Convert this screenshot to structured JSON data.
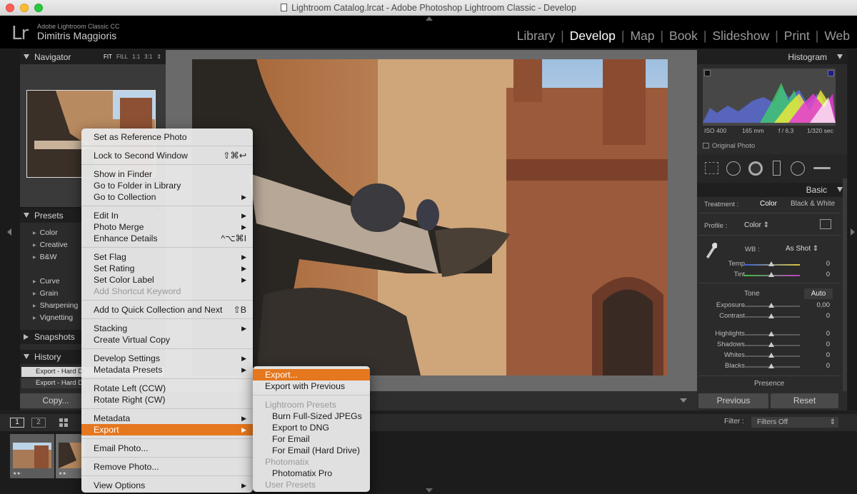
{
  "window": {
    "title": "Lightroom Catalog.lrcat - Adobe Photoshop Lightroom Classic - Develop"
  },
  "brand": {
    "logo": "Lr",
    "product": "Adobe Lightroom Classic CC",
    "user": "Dimitris Maggioris"
  },
  "modules": [
    {
      "label": "Library",
      "active": false
    },
    {
      "label": "Develop",
      "active": true
    },
    {
      "label": "Map",
      "active": false
    },
    {
      "label": "Book",
      "active": false
    },
    {
      "label": "Slideshow",
      "active": false
    },
    {
      "label": "Print",
      "active": false
    },
    {
      "label": "Web",
      "active": false
    }
  ],
  "left_panel": {
    "navigator": {
      "title": "Navigator",
      "zoom": [
        "FIT",
        "FILL",
        "1:1",
        "3:1"
      ]
    },
    "presets": {
      "title": "Presets",
      "items": [
        "Color",
        "Creative",
        "B&W",
        "Curve",
        "Grain",
        "Sharpening",
        "Vignetting"
      ]
    },
    "snapshots": {
      "title": "Snapshots"
    },
    "history": {
      "title": "History",
      "items": [
        "Export - Hard Dr",
        "Export - Hard Dr"
      ]
    },
    "copy_button": "Copy..."
  },
  "right_panel": {
    "histogram": {
      "title": "Histogram",
      "iso": "ISO 400",
      "focal": "165 mm",
      "aperture": "f / 6,3",
      "shutter": "1/320 sec",
      "original_photo": "Original Photo"
    },
    "basic": {
      "title": "Basic",
      "treatment_label": "Treatment :",
      "treatment_color": "Color",
      "treatment_bw": "Black & White",
      "profile_label": "Profile :",
      "profile_value": "Color",
      "wb_label": "WB :",
      "wb_value": "As Shot",
      "tone_label": "Tone",
      "auto_label": "Auto",
      "presence_label": "Presence",
      "sliders": [
        {
          "label": "Temp",
          "value": "0"
        },
        {
          "label": "Tint",
          "value": "0"
        },
        {
          "label": "Exposure",
          "value": "0,00"
        },
        {
          "label": "Contrast",
          "value": "0"
        },
        {
          "label": "Highlights",
          "value": "0"
        },
        {
          "label": "Shadows",
          "value": "0"
        },
        {
          "label": "Whites",
          "value": "0"
        },
        {
          "label": "Blacks",
          "value": "0"
        }
      ]
    },
    "previous_button": "Previous",
    "reset_button": "Reset"
  },
  "filmstrip": {
    "view1": "1",
    "view2": "2",
    "filter_label": "Filter :",
    "filter_value": "Filters Off"
  },
  "context_menu": {
    "items": [
      {
        "label": "Set as Reference Photo",
        "shortcut": "",
        "submenu": false,
        "disabled": false
      },
      {
        "label": "Lock to Second Window",
        "shortcut": "⇧⌘↩",
        "submenu": false,
        "disabled": false
      },
      {
        "label": "Show in Finder",
        "shortcut": "",
        "submenu": false,
        "disabled": false
      },
      {
        "label": "Go to Folder in Library",
        "shortcut": "",
        "submenu": false,
        "disabled": false
      },
      {
        "label": "Go to Collection",
        "shortcut": "",
        "submenu": true,
        "disabled": false
      },
      {
        "label": "Edit In",
        "shortcut": "",
        "submenu": true,
        "disabled": false
      },
      {
        "label": "Photo Merge",
        "shortcut": "",
        "submenu": true,
        "disabled": false
      },
      {
        "label": "Enhance Details",
        "shortcut": "^⌥⌘I",
        "submenu": false,
        "disabled": false
      },
      {
        "label": "Set Flag",
        "shortcut": "",
        "submenu": true,
        "disabled": false
      },
      {
        "label": "Set Rating",
        "shortcut": "",
        "submenu": true,
        "disabled": false
      },
      {
        "label": "Set Color Label",
        "shortcut": "",
        "submenu": true,
        "disabled": false
      },
      {
        "label": "Add Shortcut Keyword",
        "shortcut": "",
        "submenu": false,
        "disabled": true
      },
      {
        "label": "Add to Quick Collection and Next",
        "shortcut": "⇧B",
        "submenu": false,
        "disabled": false
      },
      {
        "label": "Stacking",
        "shortcut": "",
        "submenu": true,
        "disabled": false
      },
      {
        "label": "Create Virtual Copy",
        "shortcut": "",
        "submenu": false,
        "disabled": false
      },
      {
        "label": "Develop Settings",
        "shortcut": "",
        "submenu": true,
        "disabled": false
      },
      {
        "label": "Metadata Presets",
        "shortcut": "",
        "submenu": true,
        "disabled": false
      },
      {
        "label": "Rotate Left (CCW)",
        "shortcut": "",
        "submenu": false,
        "disabled": false
      },
      {
        "label": "Rotate Right (CW)",
        "shortcut": "",
        "submenu": false,
        "disabled": false
      },
      {
        "label": "Metadata",
        "shortcut": "",
        "submenu": true,
        "disabled": false
      },
      {
        "label": "Export",
        "shortcut": "",
        "submenu": true,
        "disabled": false,
        "highlighted": true
      },
      {
        "label": "Email Photo...",
        "shortcut": "",
        "submenu": false,
        "disabled": false
      },
      {
        "label": "Remove Photo...",
        "shortcut": "",
        "submenu": false,
        "disabled": false
      },
      {
        "label": "View Options",
        "shortcut": "",
        "submenu": true,
        "disabled": false
      }
    ]
  },
  "export_submenu": {
    "items": [
      {
        "label": "Export...",
        "highlighted": true,
        "disabled": false
      },
      {
        "label": "Export with Previous",
        "disabled": false
      },
      {
        "label": "Lightroom Presets",
        "disabled": true,
        "header": true
      },
      {
        "label": "Burn Full-Sized JPEGs",
        "disabled": false
      },
      {
        "label": "Export to DNG",
        "disabled": false
      },
      {
        "label": "For Email",
        "disabled": false
      },
      {
        "label": "For Email (Hard Drive)",
        "disabled": false
      },
      {
        "label": "Photomatix",
        "disabled": true,
        "header": true
      },
      {
        "label": "Photomatix Pro",
        "disabled": false
      },
      {
        "label": "User Presets",
        "disabled": true,
        "header": true
      }
    ]
  },
  "colors": {
    "accent": "#e5771f",
    "panel": "#2b2b2b",
    "background": "#1e1e1e"
  }
}
